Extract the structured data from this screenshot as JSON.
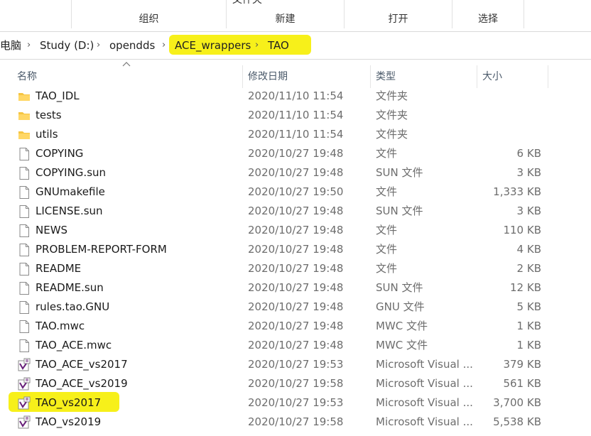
{
  "ribbon": {
    "partial_label": "文件夹",
    "groups": [
      {
        "label": "组织"
      },
      {
        "label": "新建"
      },
      {
        "label": "打开"
      },
      {
        "label": "选择"
      }
    ]
  },
  "address": {
    "crumbs": [
      {
        "label": "电脑"
      },
      {
        "label": "Study (D:)"
      },
      {
        "label": "opendds"
      },
      {
        "label": "ACE_wrappers"
      },
      {
        "label": "TAO"
      }
    ],
    "highlight_color": "#f7f01a"
  },
  "columns": {
    "name": "名称",
    "date": "修改日期",
    "type": "类型",
    "size": "大小"
  },
  "files": [
    {
      "name": "TAO_IDL",
      "date": "2020/11/10 11:54",
      "type": "文件夹",
      "size": "",
      "icon": "folder-icon"
    },
    {
      "name": "tests",
      "date": "2020/11/10 11:54",
      "type": "文件夹",
      "size": "",
      "icon": "folder-icon"
    },
    {
      "name": "utils",
      "date": "2020/11/10 11:54",
      "type": "文件夹",
      "size": "",
      "icon": "folder-icon"
    },
    {
      "name": "COPYING",
      "date": "2020/10/27 19:48",
      "type": "文件",
      "size": "6 KB",
      "icon": "file-icon"
    },
    {
      "name": "COPYING.sun",
      "date": "2020/10/27 19:48",
      "type": "SUN 文件",
      "size": "3 KB",
      "icon": "file-icon"
    },
    {
      "name": "GNUmakefile",
      "date": "2020/10/27 19:50",
      "type": "文件",
      "size": "1,333 KB",
      "icon": "file-icon"
    },
    {
      "name": "LICENSE.sun",
      "date": "2020/10/27 19:48",
      "type": "SUN 文件",
      "size": "3 KB",
      "icon": "file-icon"
    },
    {
      "name": "NEWS",
      "date": "2020/10/27 19:48",
      "type": "文件",
      "size": "110 KB",
      "icon": "file-icon"
    },
    {
      "name": "PROBLEM-REPORT-FORM",
      "date": "2020/10/27 19:48",
      "type": "文件",
      "size": "4 KB",
      "icon": "file-icon"
    },
    {
      "name": "README",
      "date": "2020/10/27 19:48",
      "type": "文件",
      "size": "2 KB",
      "icon": "file-icon"
    },
    {
      "name": "README.sun",
      "date": "2020/10/27 19:48",
      "type": "SUN 文件",
      "size": "12 KB",
      "icon": "file-icon"
    },
    {
      "name": "rules.tao.GNU",
      "date": "2020/10/27 19:48",
      "type": "GNU 文件",
      "size": "5 KB",
      "icon": "file-icon"
    },
    {
      "name": "TAO.mwc",
      "date": "2020/10/27 19:48",
      "type": "MWC 文件",
      "size": "1 KB",
      "icon": "file-icon"
    },
    {
      "name": "TAO_ACE.mwc",
      "date": "2020/10/27 19:48",
      "type": "MWC 文件",
      "size": "1 KB",
      "icon": "file-icon"
    },
    {
      "name": "TAO_ACE_vs2017",
      "date": "2020/10/27 19:53",
      "type": "Microsoft Visual ...",
      "size": "379 KB",
      "icon": "visual-studio-solution-icon"
    },
    {
      "name": "TAO_ACE_vs2019",
      "date": "2020/10/27 19:58",
      "type": "Microsoft Visual ...",
      "size": "561 KB",
      "icon": "visual-studio-solution-icon"
    },
    {
      "name": "TAO_vs2017",
      "date": "2020/10/27 19:53",
      "type": "Microsoft Visual ...",
      "size": "3,700 KB",
      "icon": "visual-studio-solution-icon"
    },
    {
      "name": "TAO_vs2019",
      "date": "2020/10/27 19:58",
      "type": "Microsoft Visual ...",
      "size": "5,538 KB",
      "icon": "visual-studio-solution-icon"
    }
  ],
  "colors": {
    "folder": "#f5c542",
    "visual_studio": "#68217a",
    "highlight": "#f7f01a"
  }
}
